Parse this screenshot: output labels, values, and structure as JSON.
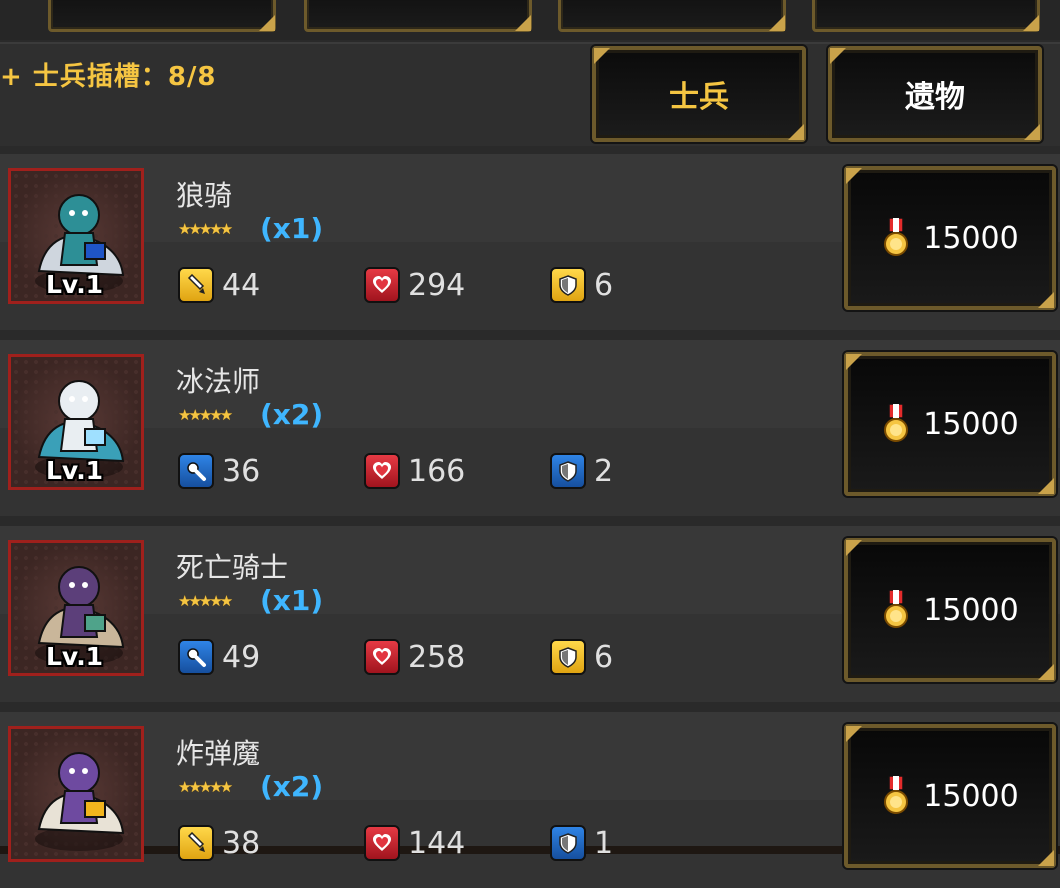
{
  "header": {
    "slot_label": "+ 士兵插槽：8/8",
    "filters": [
      {
        "label": "士兵",
        "active": true
      },
      {
        "label": "遗物",
        "active": false
      }
    ]
  },
  "units": [
    {
      "name": "狼骑",
      "level": "Lv.1",
      "stars": "★★★★★",
      "multiplier": "(x1)",
      "stats": [
        {
          "icon": "sword-icon",
          "color": "yellow",
          "value": "44"
        },
        {
          "icon": "heart-icon",
          "color": "red",
          "value": "294"
        },
        {
          "icon": "shield-icon",
          "color": "yellow",
          "value": "6"
        }
      ],
      "price": "15000"
    },
    {
      "name": "冰法师",
      "level": "Lv.1",
      "stars": "★★★★★",
      "multiplier": "(x2)",
      "stats": [
        {
          "icon": "magic-icon",
          "color": "blue",
          "value": "36"
        },
        {
          "icon": "heart-icon",
          "color": "red",
          "value": "166"
        },
        {
          "icon": "shield-icon",
          "color": "blue",
          "value": "2"
        }
      ],
      "price": "15000"
    },
    {
      "name": "死亡骑士",
      "level": "Lv.1",
      "stars": "★★★★★",
      "multiplier": "(x1)",
      "stats": [
        {
          "icon": "magic-icon",
          "color": "blue",
          "value": "49"
        },
        {
          "icon": "heart-icon",
          "color": "red",
          "value": "258"
        },
        {
          "icon": "shield-icon",
          "color": "yellow",
          "value": "6"
        }
      ],
      "price": "15000"
    },
    {
      "name": "炸弹魔",
      "level": "",
      "stars": "★★★★★",
      "multiplier": "(x2)",
      "stats": [
        {
          "icon": "sword-icon",
          "color": "yellow",
          "value": "38"
        },
        {
          "icon": "heart-icon",
          "color": "red",
          "value": "144"
        },
        {
          "icon": "shield-icon",
          "color": "blue",
          "value": "1"
        }
      ],
      "price": "15000"
    }
  ],
  "colors": {
    "gold": "#f5c542",
    "accent_blue": "#3fb6ff",
    "frame": "#6d5a2b",
    "portrait_border": "#a0201c"
  }
}
